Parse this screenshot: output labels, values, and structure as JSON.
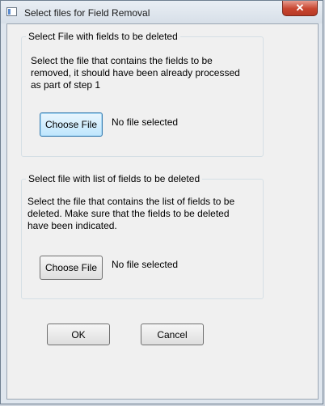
{
  "window": {
    "title": "Select files for Field Removal",
    "close_label": "✕"
  },
  "group1": {
    "legend": "Select File with fields to be deleted",
    "description": "Select the file that contains the fields to be removed, it should have been already processed as part of step 1",
    "button_label": "Choose File",
    "status": "No file selected"
  },
  "group2": {
    "legend": "Select file with list of fields to be deleted",
    "description": "Select the file that contains the list of fields to be deleted.  Make sure that the fields to be deleted have been indicated.",
    "button_label": "Choose File",
    "status": "No file selected"
  },
  "actions": {
    "ok_label": "OK",
    "cancel_label": "Cancel"
  }
}
